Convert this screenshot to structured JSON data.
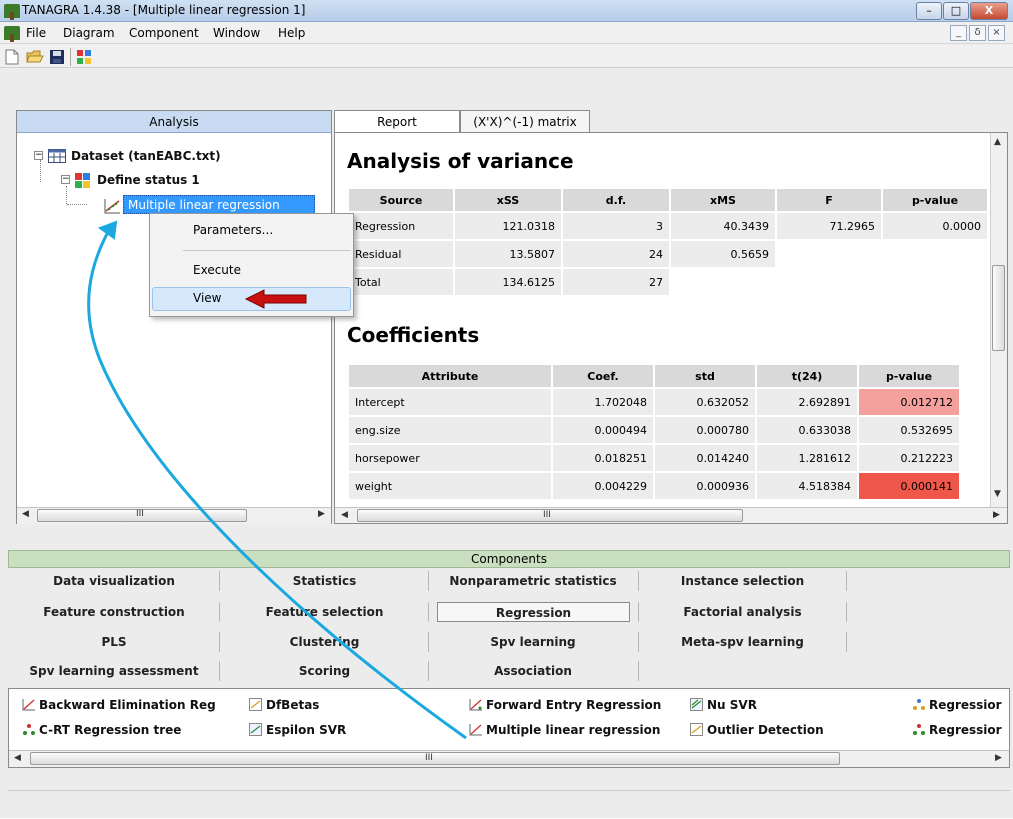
{
  "window": {
    "title": "TANAGRA 1.4.38 - [Multiple linear regression 1]",
    "minimize": "–",
    "maximize": "□",
    "close": "X"
  },
  "menu": [
    "File",
    "Diagram",
    "Component",
    "Window",
    "Help"
  ],
  "mdi_buttons": [
    "_",
    "ẟ",
    "×"
  ],
  "analysis": {
    "header": "Analysis",
    "tree": {
      "dataset": "Dataset (tanEABC.txt)",
      "status": "Define status 1",
      "regression": "Multiple linear regression"
    }
  },
  "context_menu": {
    "items": [
      "Parameters...",
      "Execute",
      "View"
    ],
    "highlighted": "View"
  },
  "report_tabs": [
    "Report",
    "(X'X)^(-1) matrix"
  ],
  "anova": {
    "heading": "Analysis of variance",
    "columns": [
      "Source",
      "xSS",
      "d.f.",
      "xMS",
      "F",
      "p-value"
    ],
    "rows": [
      [
        "Regression",
        "121.0318",
        "3",
        "40.3439",
        "71.2965",
        "0.0000"
      ],
      [
        "Residual",
        "13.5807",
        "24",
        "0.5659",
        "",
        ""
      ],
      [
        "Total",
        "134.6125",
        "27",
        "",
        "",
        ""
      ]
    ]
  },
  "coefficients": {
    "heading": "Coefficients",
    "columns": [
      "Attribute",
      "Coef.",
      "std",
      "t(24)",
      "p-value"
    ],
    "rows": [
      [
        "Intercept",
        "1.702048",
        "0.632052",
        "2.692891",
        "0.012712"
      ],
      [
        "eng.size",
        "0.000494",
        "0.000780",
        "0.633038",
        "0.532695"
      ],
      [
        "horsepower",
        "0.018251",
        "0.014240",
        "1.281612",
        "0.212223"
      ],
      [
        "weight",
        "0.004229",
        "0.000936",
        "4.518384",
        "0.000141"
      ]
    ],
    "pvalue_colors": [
      "#f4a09c",
      "#ececec",
      "#ececec",
      "#f0574b"
    ]
  },
  "scroll_grip": "III",
  "components": {
    "header": "Components",
    "tabs": [
      [
        "Data visualization",
        "Statistics",
        "Nonparametric statistics",
        "Instance selection"
      ],
      [
        "Feature construction",
        "Feature selection",
        "Regression",
        "Factorial analysis"
      ],
      [
        "PLS",
        "Clustering",
        "Spv learning",
        "Meta-spv learning"
      ],
      [
        "Spv learning assessment",
        "Scoring",
        "Association"
      ]
    ],
    "selected": "Regression",
    "items": [
      "Backward Elimination Reg",
      "DfBetas",
      "Forward Entry Regression",
      "Nu SVR",
      "Regressior",
      "C-RT Regression tree",
      "Espilon SVR",
      "Multiple linear regression",
      "Outlier Detection",
      "Regressior"
    ]
  },
  "colors": {
    "annotation_arrow": "#1aa8e0",
    "pointer_arrow": "#c81010",
    "selection": "#3399ff"
  }
}
